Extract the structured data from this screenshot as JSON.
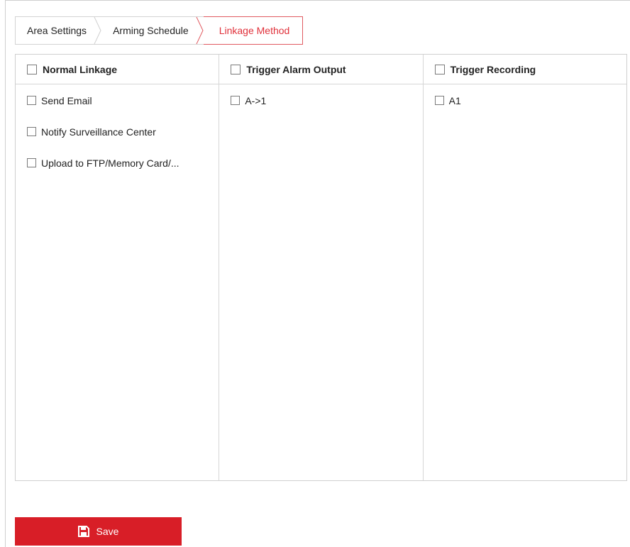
{
  "tabs": [
    {
      "label": "Area Settings",
      "active": false
    },
    {
      "label": "Arming Schedule",
      "active": false
    },
    {
      "label": "Linkage Method",
      "active": true
    }
  ],
  "columns": [
    {
      "header": "Normal Linkage",
      "items": [
        "Send Email",
        "Notify Surveillance Center",
        "Upload to FTP/Memory Card/..."
      ]
    },
    {
      "header": "Trigger Alarm Output",
      "items": [
        "A->1"
      ]
    },
    {
      "header": "Trigger Recording",
      "items": [
        "A1"
      ]
    }
  ],
  "save_button": {
    "label": "Save",
    "icon": "save-icon"
  },
  "colors": {
    "accent": "#d81e27",
    "active_tab_text": "#e0303a",
    "border": "#cfcfcf"
  }
}
